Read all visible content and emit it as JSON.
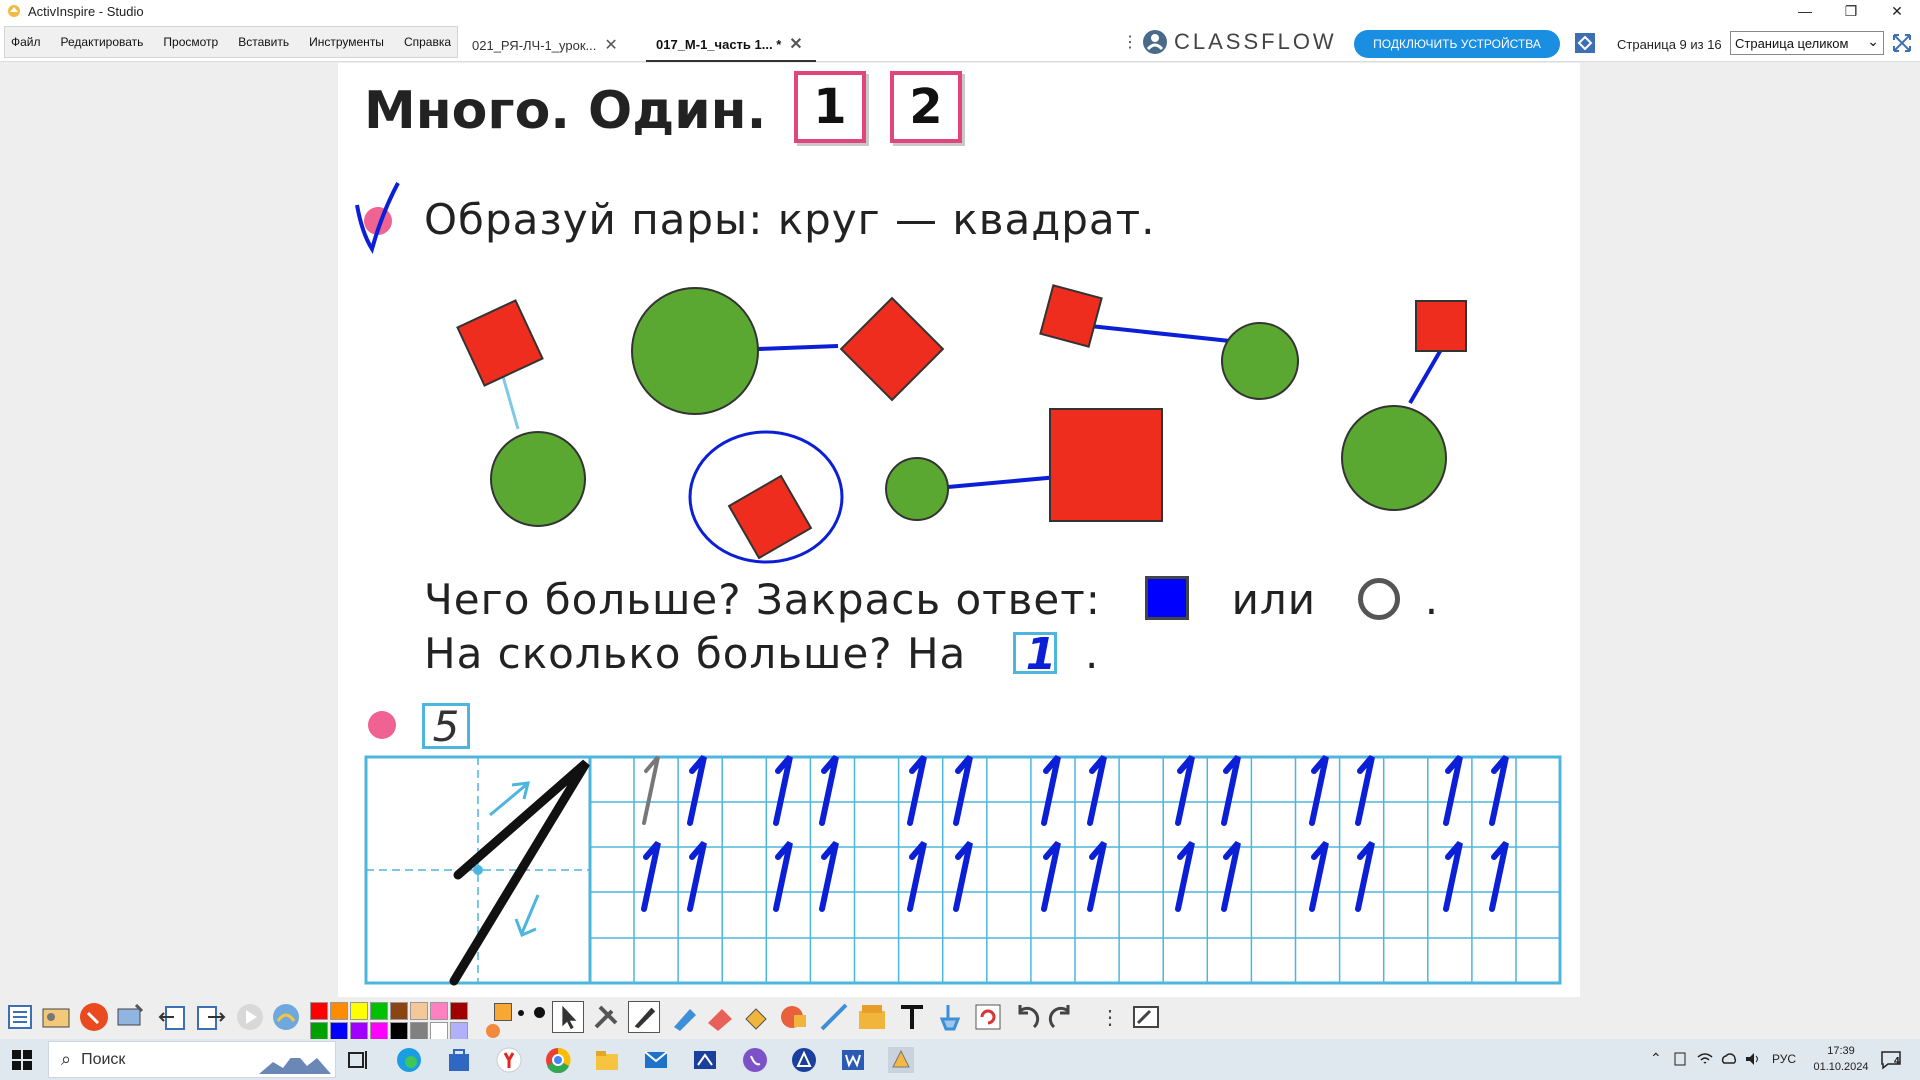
{
  "window": {
    "title": "ActivInspire - Studio"
  },
  "menu": {
    "items": [
      "Файл",
      "Редактировать",
      "Просмотр",
      "Вставить",
      "Инструменты",
      "Справка"
    ]
  },
  "tabs": [
    {
      "label": "021_РЯ-ЛЧ-1_урок..."
    },
    {
      "label": "017_М-1_часть 1... *"
    }
  ],
  "classflow": {
    "brand": "CLASSFLOW",
    "connect_label": "ПОДКЛЮЧИТЬ УСТРОЙСТВА"
  },
  "pager": {
    "counter": "Страница 9 из 16",
    "zoom": "Страница целиком"
  },
  "content": {
    "heading_many": "Много.",
    "heading_one": "Один.",
    "badge_1": "1",
    "badge_2": "2",
    "task1": "Образуй пары: круг — квадрат.",
    "q1_a": "Чего больше? Закрась ответ:",
    "q1_or": "или",
    "q1_dot": ".",
    "q2_a": "На сколько больше? На",
    "q2_dot": ".",
    "box_handwritten": "1",
    "task2_number": "5"
  },
  "toolbar": {
    "colors_top": [
      "#ff0000",
      "#ff8c00",
      "#ffff00",
      "#00c000",
      "#8b4513",
      "#f5c89a",
      "#ff80c0",
      "#a00000"
    ],
    "colors_bottom": [
      "#00a000",
      "#0000ff",
      "#a000ff",
      "#ff00ff",
      "#000000",
      "#808080",
      "#ffffff",
      "#b0b0ff"
    ]
  },
  "taskbar": {
    "search_placeholder": "Поиск",
    "language": "РУС",
    "time": "17:39",
    "date": "01.10.2024",
    "notifications": "4"
  },
  "colors": {
    "accent": "#1a8ee0",
    "ink": "#0a1fd6",
    "shape_red": "#ee2d1f",
    "shape_green": "#5aa832",
    "badge_border": "#e0457b",
    "grid": "#4db5de"
  }
}
